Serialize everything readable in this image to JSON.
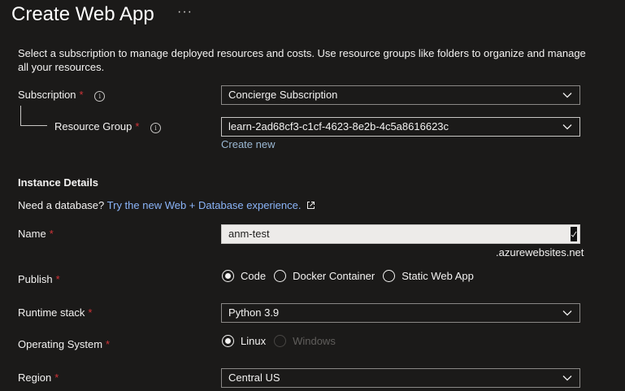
{
  "header": {
    "title": "Create Web App",
    "more_label": "···"
  },
  "intro": "Select a subscription to manage deployed resources and costs. Use resource groups like folders to organize and manage all your resources.",
  "subscription": {
    "label": "Subscription",
    "required": "*",
    "value": "Concierge Subscription"
  },
  "resource_group": {
    "label": "Resource Group",
    "required": "*",
    "value": "learn-2ad68cf3-c1cf-4623-8e2b-4c5a8616623c",
    "create_new": "Create new"
  },
  "instance": {
    "heading": "Instance Details",
    "db_prompt": "Need a database?",
    "db_link": "Try the new Web + Database experience."
  },
  "name": {
    "label": "Name",
    "required": "*",
    "value": "anm-test",
    "suffix": ".azurewebsites.net"
  },
  "publish": {
    "label": "Publish",
    "required": "*",
    "options": [
      "Code",
      "Docker Container",
      "Static Web App"
    ],
    "selected": "Code"
  },
  "runtime": {
    "label": "Runtime stack",
    "required": "*",
    "value": "Python 3.9"
  },
  "os": {
    "label": "Operating System",
    "required": "*",
    "options": [
      "Linux",
      "Windows"
    ],
    "selected": "Linux",
    "disabled": "Windows"
  },
  "region": {
    "label": "Region",
    "required": "*",
    "value": "Central US"
  },
  "colors": {
    "background": "#1b1a19",
    "text": "#f3f2f1",
    "link": "#8ab4f8",
    "required": "#d13438",
    "border": "#8a8886"
  }
}
